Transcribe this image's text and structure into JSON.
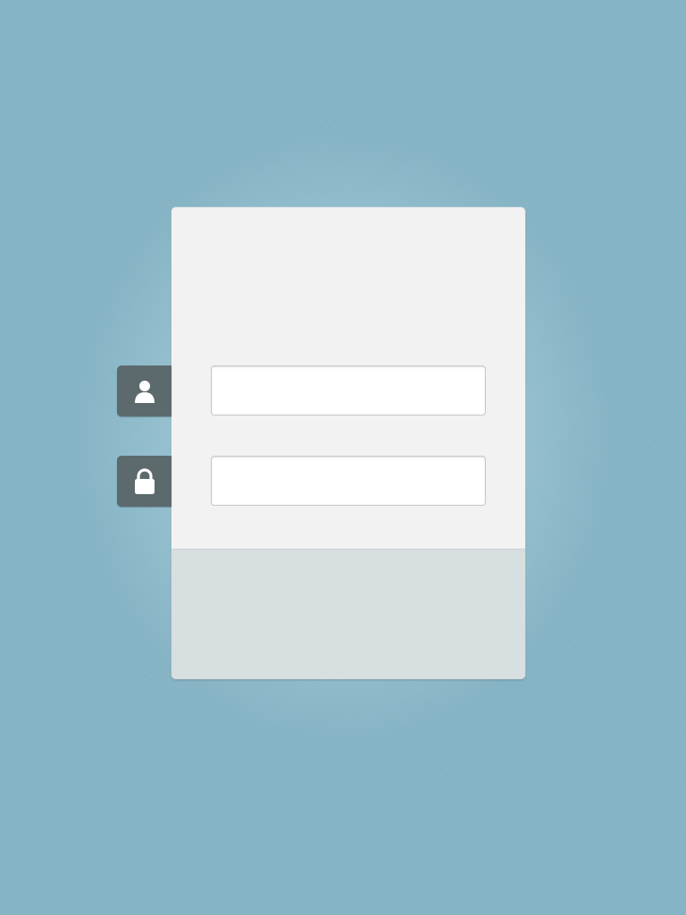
{
  "login_form": {
    "username_field": {
      "value": "",
      "placeholder": "",
      "icon": "user-icon"
    },
    "password_field": {
      "value": "",
      "placeholder": "",
      "icon": "lock-icon"
    }
  },
  "colors": {
    "background": "#86b5c6",
    "card_body": "#f2f2f2",
    "card_footer": "#d7dfe0",
    "icon_tab": "#5c6a6d",
    "icon_glyph": "#ffffff"
  }
}
